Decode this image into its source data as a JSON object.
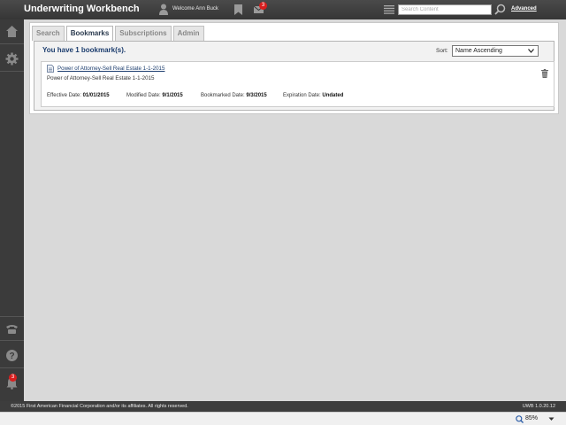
{
  "header": {
    "title": "Underwriting Workbench",
    "welcome": "Welcome Ann Buck",
    "mail_count": "3",
    "search_placeholder": "Search Content",
    "advanced_label": "Advanced"
  },
  "sidebar": {
    "items": [
      {
        "icon": "home-icon"
      },
      {
        "icon": "gear-icon"
      },
      {
        "icon": "phone-icon"
      },
      {
        "icon": "help-icon"
      },
      {
        "icon": "bell-icon",
        "badge": "3"
      }
    ]
  },
  "tabs": [
    {
      "label": "Search",
      "active": false
    },
    {
      "label": "Bookmarks",
      "active": true
    },
    {
      "label": "Subscriptions",
      "active": false
    },
    {
      "label": "Admin",
      "active": false
    }
  ],
  "bookmarks": {
    "count_text": "You have 1 bookmark(s).",
    "sort_label": "Sort:",
    "sort_value": "Name Ascending",
    "items": [
      {
        "title": "Power of Attorney-Sell Real Estate 1-1-2015",
        "description": "Power of Attorney-Sell Real Estate 1-1-2015",
        "effective_label": "Effective Date:",
        "effective_value": "01/01/2015",
        "modified_label": "Modified Date:",
        "modified_value": "9/1/2015",
        "bookmarked_label": "Bookmarked Date:",
        "bookmarked_value": "9/3/2015",
        "expiration_label": "Expiration Date:",
        "expiration_value": "Undated"
      }
    ]
  },
  "footer": {
    "copyright": "©2015 First American Financial Corporation and/or its affiliates. All rights reserved.",
    "version": "UWB 1.0.20.12"
  },
  "statusbar": {
    "zoom": "85%"
  },
  "colors": {
    "topbar": "#3b3b3b",
    "accent": "#1c3d6e",
    "badge": "#d81e1e"
  }
}
